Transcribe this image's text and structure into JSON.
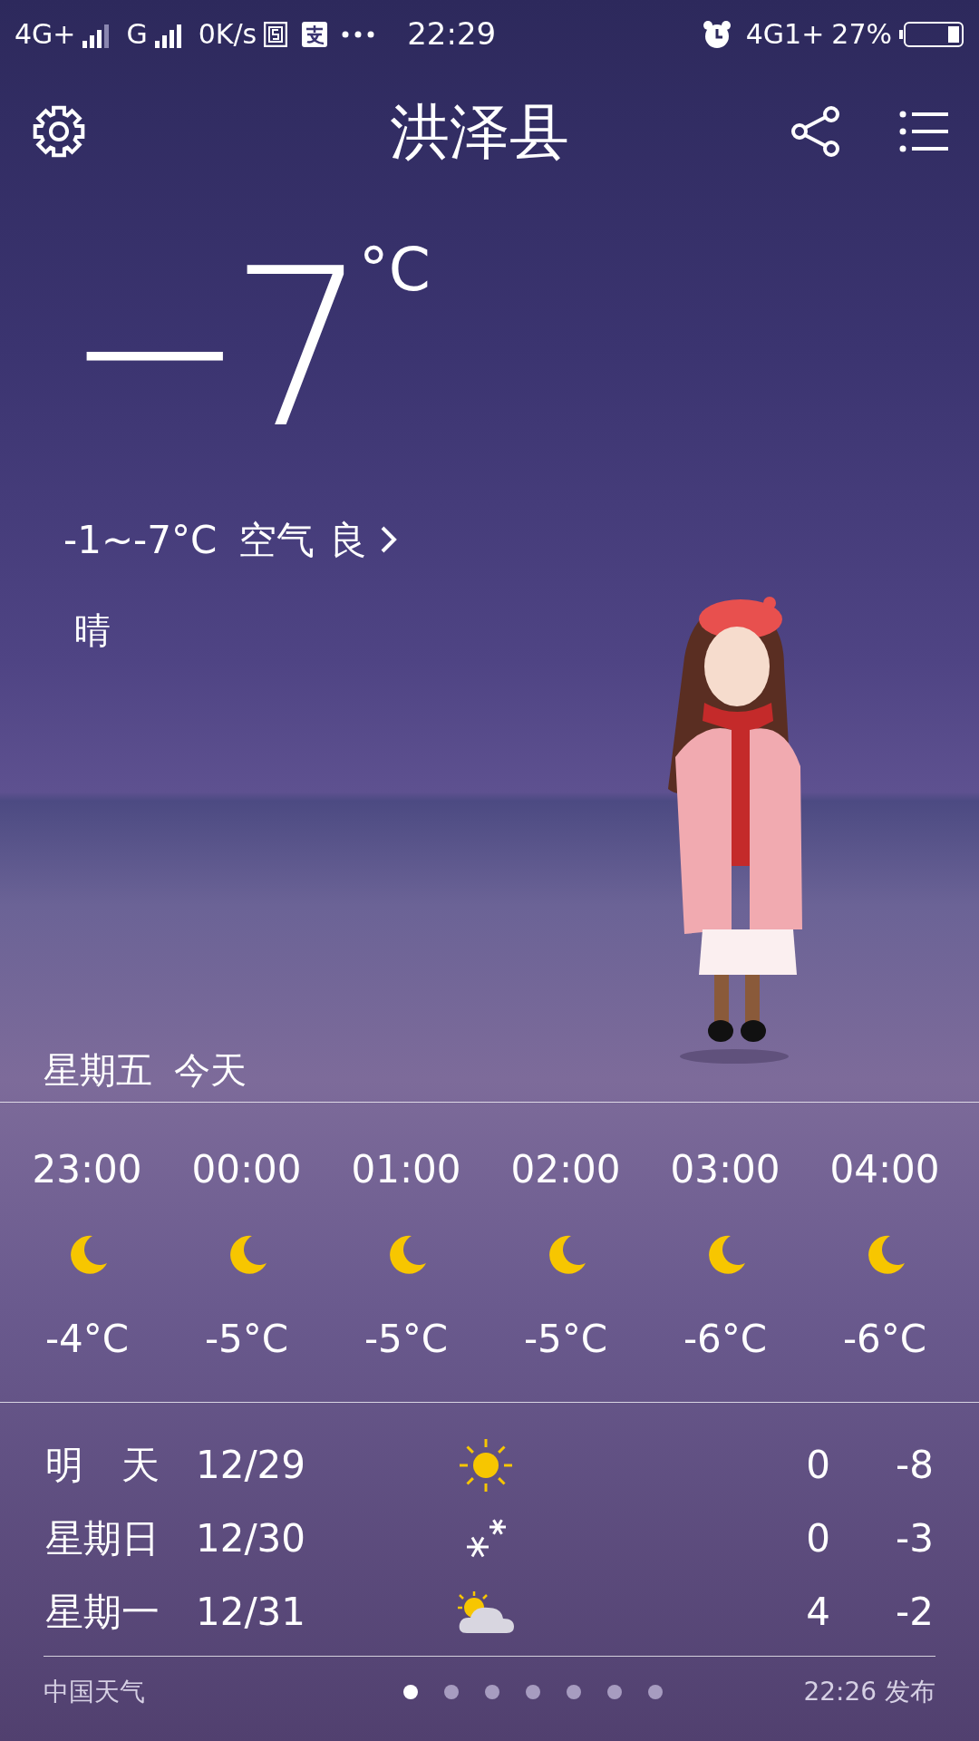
{
  "status_bar": {
    "left": [
      "4G+",
      "G",
      "0K/s"
    ],
    "time": "22:29",
    "network": "4G1+",
    "battery": "27%"
  },
  "header": {
    "title": "洪泽县"
  },
  "current": {
    "temp": "−7",
    "unit": "°C",
    "range": "-1~-7°C",
    "air_label": "空气",
    "air_value": "良",
    "condition": "晴"
  },
  "today": {
    "weekday": "星期五",
    "label": "今天"
  },
  "hourly": [
    {
      "time": "23:00",
      "kind": "moon",
      "temp": "-4°C"
    },
    {
      "time": "00:00",
      "kind": "moon",
      "temp": "-5°C"
    },
    {
      "time": "01:00",
      "kind": "moon",
      "temp": "-5°C"
    },
    {
      "time": "02:00",
      "kind": "moon",
      "temp": "-5°C"
    },
    {
      "time": "03:00",
      "kind": "moon",
      "temp": "-6°C"
    },
    {
      "time": "04:00",
      "kind": "moon",
      "temp": "-6°C"
    }
  ],
  "daily": [
    {
      "day": "明　天",
      "date": "12/29",
      "kind": "sunny",
      "high": "0",
      "low": "-8"
    },
    {
      "day": "星期日",
      "date": "12/30",
      "kind": "snow",
      "high": "0",
      "low": "-3"
    },
    {
      "day": "星期一",
      "date": "12/31",
      "kind": "partly_cloudy",
      "high": "4",
      "low": "-2"
    }
  ],
  "footer": {
    "source": "中国天气",
    "published": "22:26 发布",
    "pages": [
      {
        "selected": true
      },
      {
        "selected": false
      },
      {
        "selected": false
      },
      {
        "selected": false
      },
      {
        "selected": false
      },
      {
        "selected": false
      },
      {
        "selected": false
      }
    ]
  }
}
